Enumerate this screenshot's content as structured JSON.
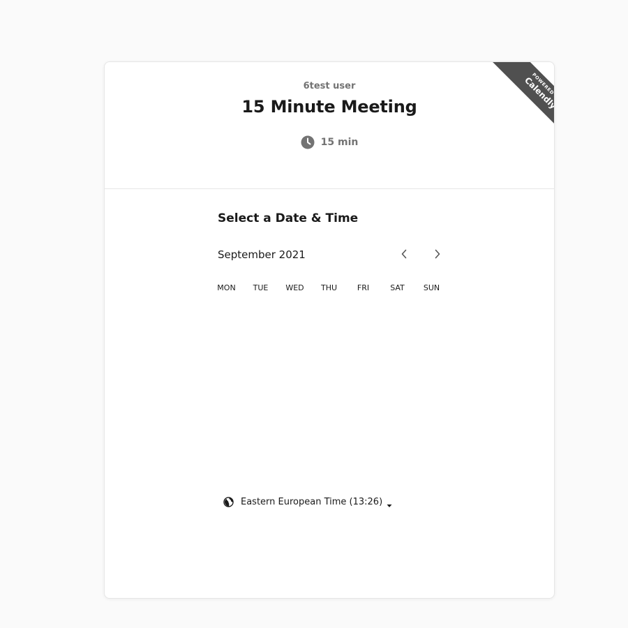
{
  "event": {
    "owner": "6test user",
    "title": "15 Minute Meeting",
    "duration": "15 min",
    "duration_icon": "clock-icon"
  },
  "badge": {
    "small_text": "POWERED BY",
    "brand": "Calendly",
    "color": "#505050"
  },
  "scheduler": {
    "heading": "Select a Date & Time",
    "month_label": "September 2021",
    "prev_icon": "chevron-left-icon",
    "next_icon": "chevron-right-icon",
    "weekdays": [
      "MON",
      "TUE",
      "WED",
      "THU",
      "FRI",
      "SAT",
      "SUN"
    ]
  },
  "timezone": {
    "label": "Eastern European Time (13:26)",
    "icon": "globe-icon",
    "dropdown_icon": "caret-down-icon"
  },
  "colors": {
    "page_bg": "#fafafa",
    "card_bg": "#ffffff",
    "muted_text": "#737373",
    "primary_text": "#1a1a1a"
  }
}
